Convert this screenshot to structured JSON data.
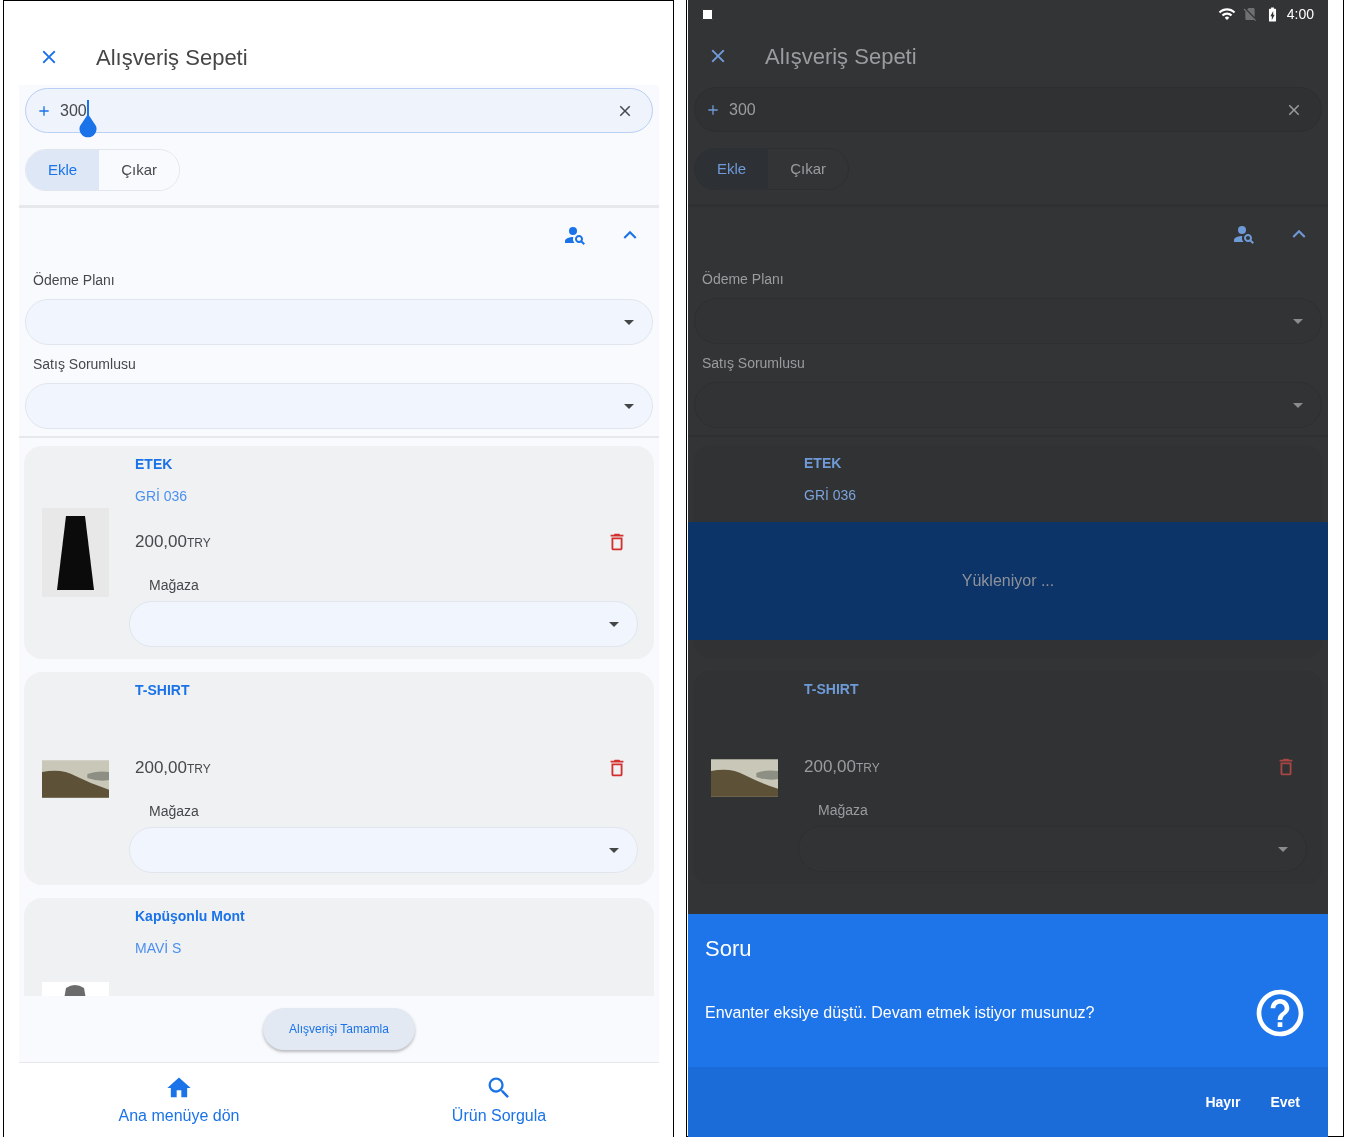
{
  "left_screen": {
    "header": {
      "title": "Alışveriş Sepeti"
    },
    "quantity_field": {
      "value": "300",
      "focused": true
    },
    "mode_toggle": [
      {
        "label": "Ekle",
        "selected": true
      },
      {
        "label": "Çıkar",
        "selected": false
      }
    ],
    "section": {
      "expanded": true
    },
    "fields": [
      {
        "label": "Ödeme Planı"
      },
      {
        "label": "Satış Sorumlusu"
      }
    ],
    "cart_items": [
      {
        "name": "ETEK",
        "variant": "GRİ 036",
        "price": "200,00",
        "currency": "TRY",
        "store_label": "Mağaza",
        "kind": "skirt"
      },
      {
        "name": "T-SHIRT",
        "price": "200,00",
        "currency": "TRY",
        "store_label": "Mağaza",
        "kind": "landscape"
      },
      {
        "name": "Kapüşonlu Mont",
        "variant": "MAVİ S",
        "kind": "jacket"
      }
    ],
    "complete_button": "Alışverişi Tamamla",
    "bottom_nav": [
      {
        "label": "Ana menüye dön",
        "kind": "home"
      },
      {
        "label": "Ürün Sorgula",
        "kind": "search"
      }
    ]
  },
  "right_screen": {
    "status_bar": {
      "time": "4:00"
    },
    "header": {
      "title": "Alışveriş Sepeti"
    },
    "quantity_field": {
      "value": "300",
      "focused": false
    },
    "mode_toggle": [
      {
        "label": "Ekle",
        "selected": true
      },
      {
        "label": "Çıkar",
        "selected": false
      }
    ],
    "section": {
      "expanded": true
    },
    "fields": [
      {
        "label": "Ödeme Planı"
      },
      {
        "label": "Satış Sorumlusu"
      }
    ],
    "cart_items": [
      {
        "name": "ETEK",
        "variant": "GRİ 036"
      },
      {
        "name": "T-SHIRT",
        "price": "200,00",
        "currency": "TRY",
        "store_label": "Mağaza",
        "kind": "landscape"
      }
    ],
    "loading": {
      "text": "Yükleniyor ..."
    },
    "dialog": {
      "title": "Soru",
      "message": "Envanter eksiye düştü. Devam etmek istiyor musunuz?",
      "buttons": [
        "Hayır",
        "Evet"
      ]
    }
  }
}
